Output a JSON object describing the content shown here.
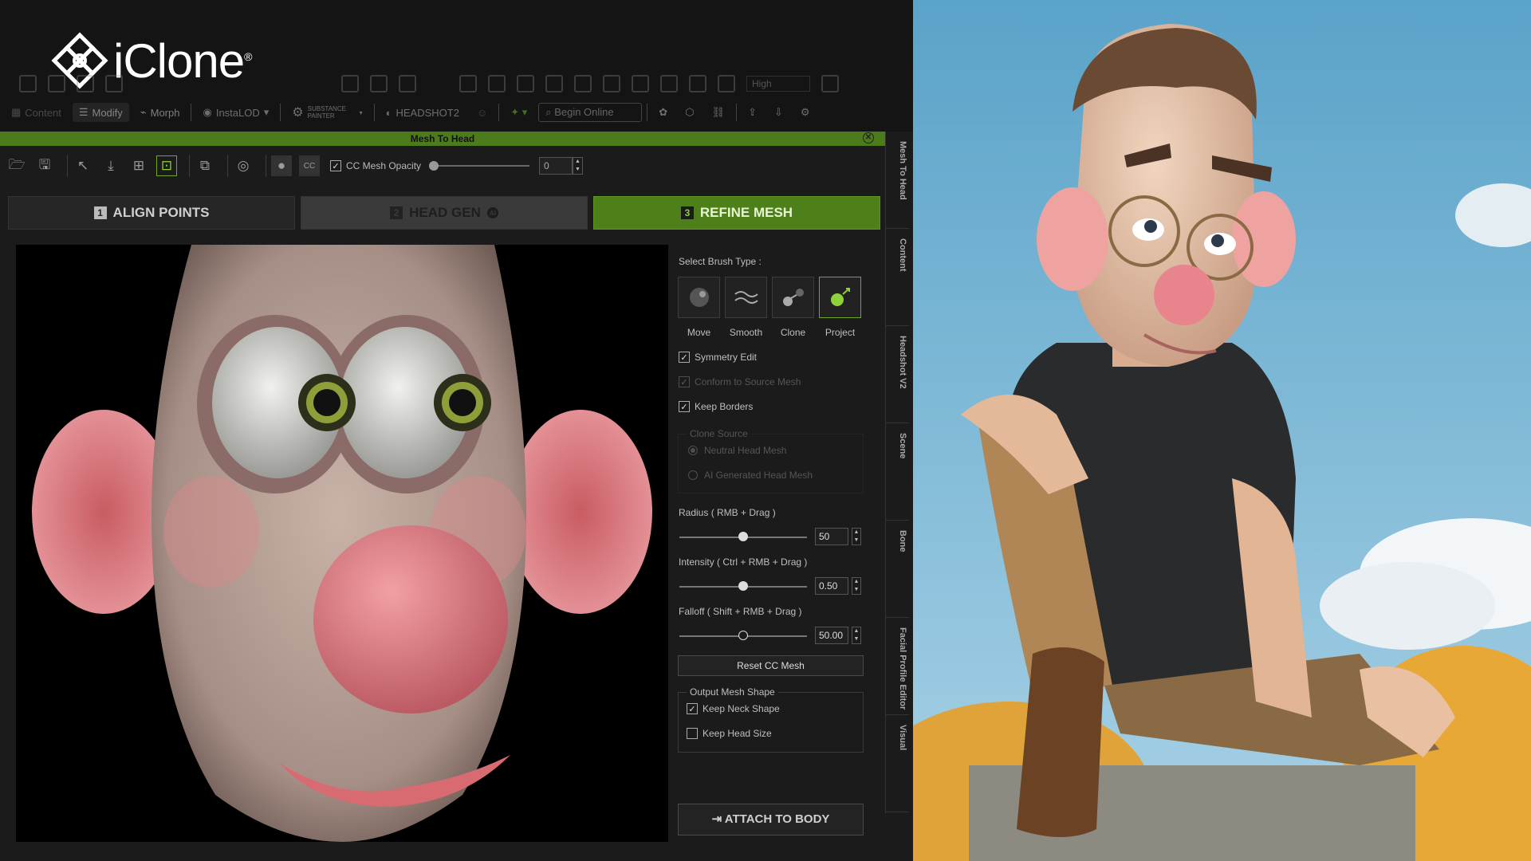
{
  "app": {
    "name": "iClone",
    "reg": "®"
  },
  "toolbar2": {
    "content": "Content",
    "modify": "Modify",
    "morph": "Morph",
    "instalod": "InstaLOD",
    "substance": "SUBSTANCE PAINTER",
    "headshot": "HEADSHOT2",
    "search_placeholder": "Begin Online"
  },
  "quality": "High",
  "panel_title": "Mesh To Head",
  "tools": {
    "cc_mesh_opacity_label": "CC Mesh Opacity",
    "cc_mesh_opacity_value": "0",
    "cc_mesh_opacity_fraction": 0
  },
  "steps": [
    {
      "num": "1",
      "label": "ALIGN POINTS"
    },
    {
      "num": "2",
      "label": "HEAD GEN",
      "badge": "AI"
    },
    {
      "num": "3",
      "label": "REFINE MESH"
    }
  ],
  "brush": {
    "title": "Select Brush Type :",
    "types": [
      {
        "label": "Move"
      },
      {
        "label": "Smooth"
      },
      {
        "label": "Clone"
      },
      {
        "label": "Project",
        "selected": true
      }
    ]
  },
  "options": {
    "symmetry_edit": "Symmetry Edit",
    "conform_to_source": "Conform to Source Mesh",
    "keep_borders": "Keep Borders"
  },
  "clone_source": {
    "title": "Clone Source",
    "neutral": "Neutral Head Mesh",
    "ai_generated": "AI Generated Head Mesh"
  },
  "sliders": {
    "radius": {
      "label": "Radius ( RMB + Drag )",
      "value": "50",
      "fraction": 0.5
    },
    "intensity": {
      "label": "Intensity ( Ctrl + RMB + Drag )",
      "value": "0.50",
      "fraction": 0.5
    },
    "falloff": {
      "label": "Falloff ( Shift + RMB + Drag )",
      "value": "50.00",
      "fraction": 0.5
    }
  },
  "reset_button": "Reset CC Mesh",
  "output": {
    "title": "Output Mesh Shape",
    "keep_neck": "Keep Neck Shape",
    "keep_head": "Keep Head Size"
  },
  "attach_button": "ATTACH TO BODY",
  "side_tabs": [
    "Mesh To Head",
    "Content",
    "Headshot V2",
    "Scene",
    "Bone",
    "Facial Profile Editor",
    "Visual"
  ]
}
